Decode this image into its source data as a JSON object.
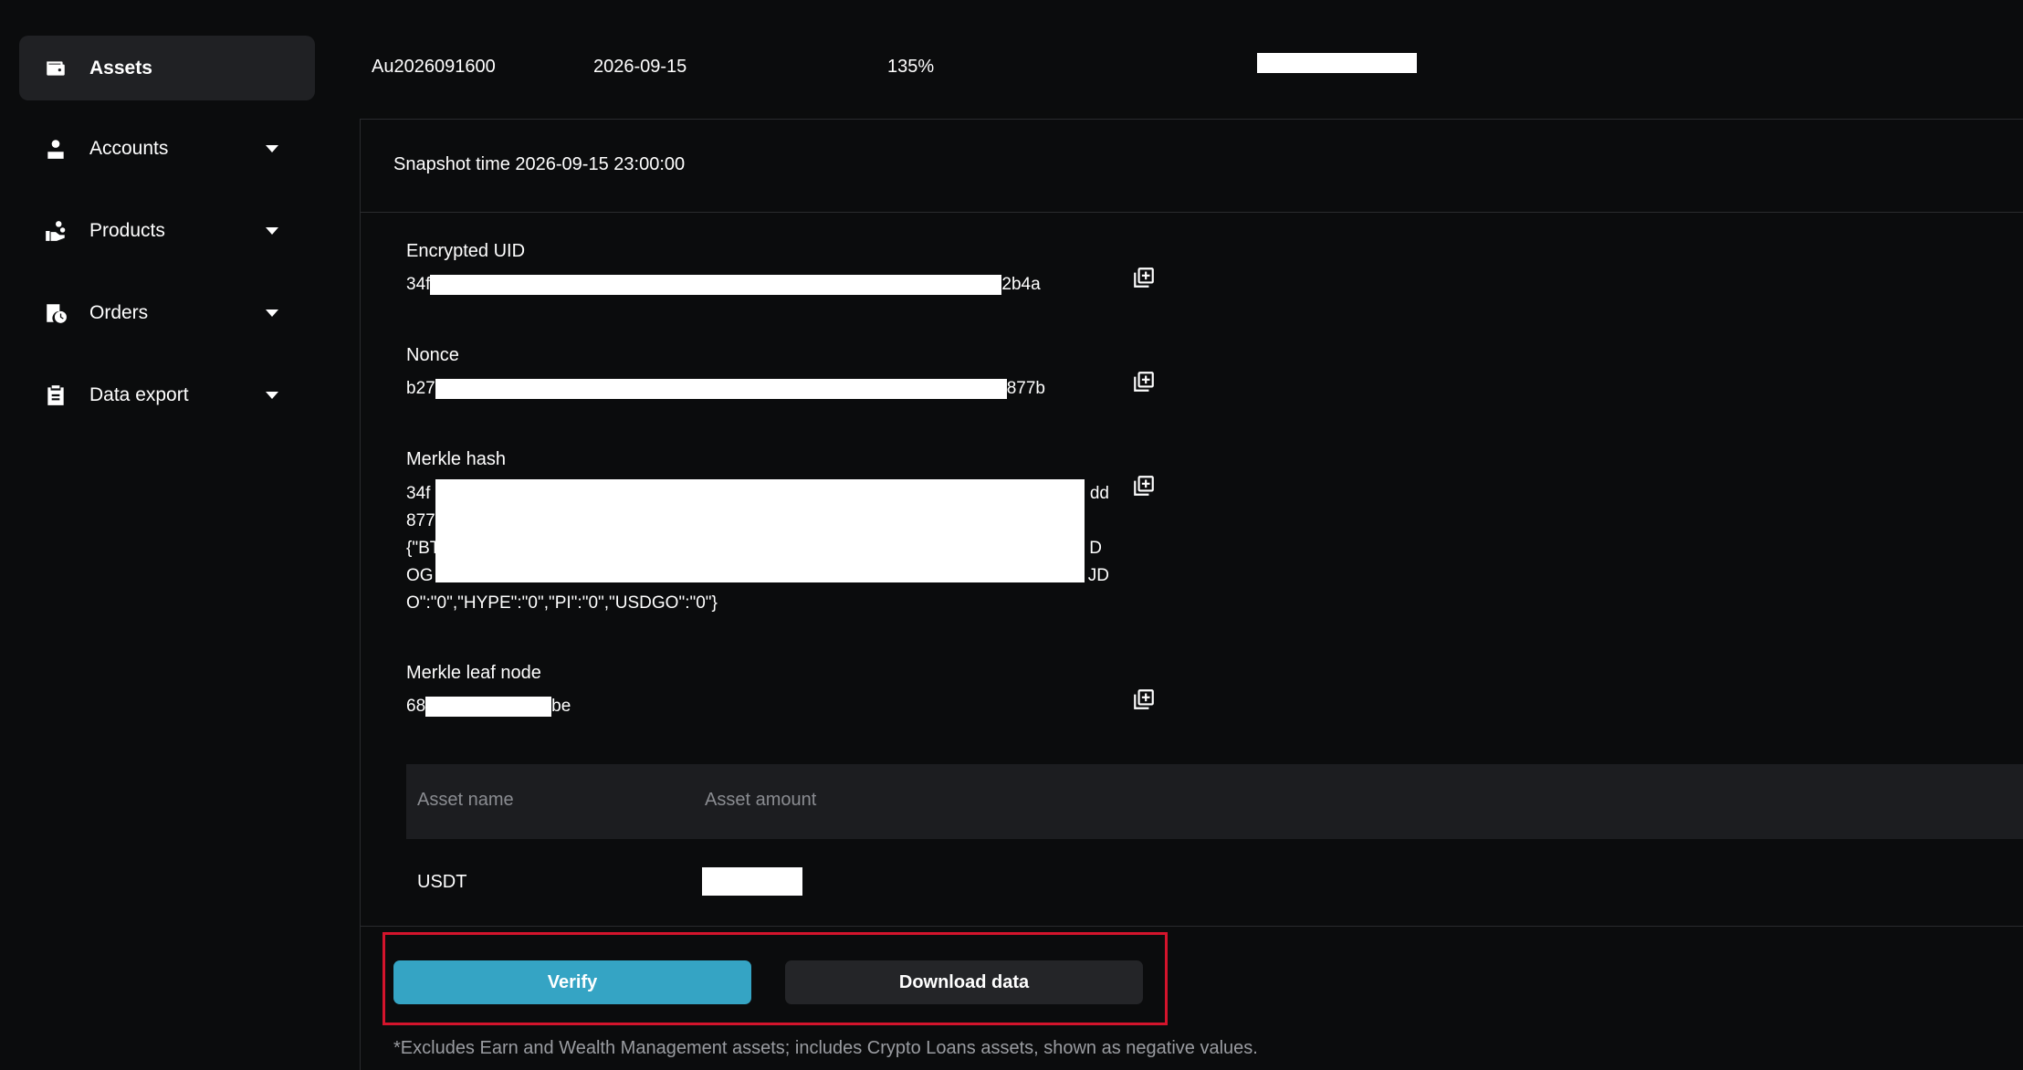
{
  "sidebar": {
    "items": [
      {
        "label": "Assets",
        "icon": "wallet-icon",
        "active": true
      },
      {
        "label": "Accounts",
        "icon": "user-icon"
      },
      {
        "label": "Products",
        "icon": "hand-coins-icon"
      },
      {
        "label": "Orders",
        "icon": "clock-list-icon"
      },
      {
        "label": "Data export",
        "icon": "clipboard-icon"
      }
    ]
  },
  "top_row": {
    "audit_id": "Au2026091600",
    "date": "2026-09-15",
    "ratio": "135%"
  },
  "panel": {
    "snapshot_time": "Snapshot time 2026-09-15 23:00:00",
    "fields": {
      "encrypted_uid": {
        "label": "Encrypted UID",
        "prefix": "34f",
        "suffix": "2b4a"
      },
      "nonce": {
        "label": "Nonce",
        "prefix": "b27",
        "suffix": "877b"
      },
      "merkle_hash": {
        "label": "Merkle hash",
        "lines": [
          "34f",
          "877",
          "{\"BT",
          "OG",
          "O\":\"0\",\"HYPE\":\"0\",\"PI\":\"0\",\"USDGO\":\"0\"}"
        ],
        "line_ends": [
          "dd",
          "",
          "D",
          "JD",
          ""
        ]
      },
      "merkle_leaf": {
        "label": "Merkle leaf node",
        "prefix": "68",
        "suffix": "be"
      }
    },
    "table": {
      "headers": [
        "Asset name",
        "Asset amount"
      ],
      "rows": [
        {
          "asset": "USDT",
          "amount": ""
        }
      ]
    },
    "buttons": {
      "verify": "Verify",
      "download": "Download data"
    },
    "footnote": "*Excludes Earn and Wealth Management assets; includes Crypto Loans assets, shown as negative values."
  },
  "colors": {
    "accent": "#35a4c4",
    "highlight": "#d4142c",
    "background": "#0b0c0d"
  }
}
